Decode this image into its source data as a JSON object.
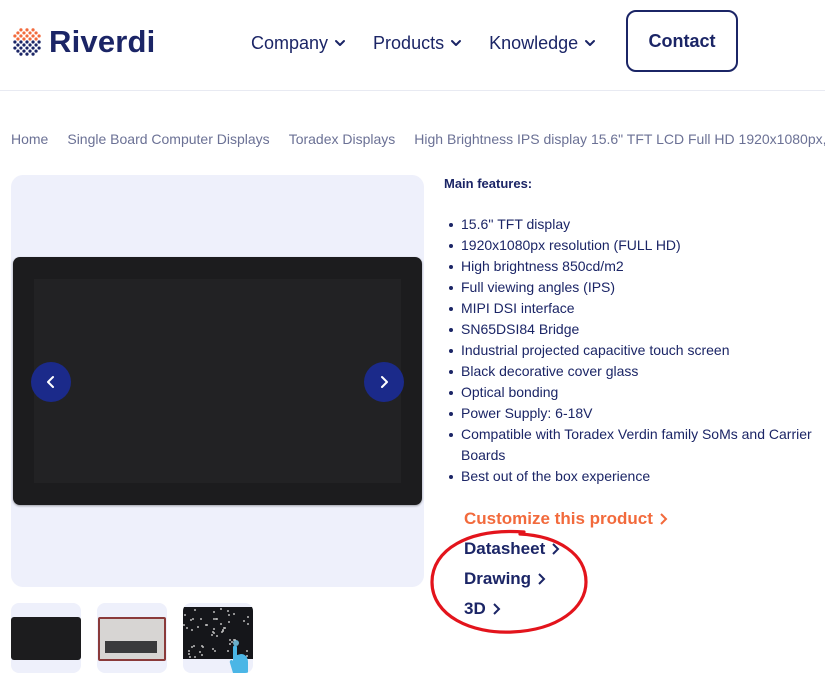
{
  "brand": {
    "name": "Riverdi",
    "accent": "#f26a3c",
    "navy": "#1b2566"
  },
  "nav": {
    "items": [
      {
        "label": "Company",
        "icon": "chevron-down-icon"
      },
      {
        "label": "Products",
        "icon": "chevron-down-icon"
      },
      {
        "label": "Knowledge",
        "icon": "chevron-down-icon"
      }
    ],
    "contact_label": "Contact"
  },
  "breadcrumb": [
    "Home",
    "Single Board Computer Displays",
    "Toradex Displays",
    "High Brightness IPS display 15.6\" TFT LCD Full HD 1920x1080px,"
  ],
  "gallery": {
    "prev_icon": "chevron-left-icon",
    "next_icon": "chevron-right-icon"
  },
  "features": {
    "title": "Main features:",
    "items": [
      "15.6'' TFT display",
      "1920x1080px resolution (FULL HD)",
      "High brightness 850cd/m2",
      "Full viewing angles (IPS)",
      "MIPI DSI interface",
      "SN65DSI84 Bridge",
      "Industrial projected capacitive touch screen",
      "Black decorative cover glass",
      "Optical bonding",
      "Power Supply: 6-18V",
      "Compatible with Toradex Verdin family SoMs and Carrier Boards",
      "Best out of the box experience"
    ]
  },
  "links": {
    "customize": "Customize this product",
    "datasheet": "Datasheet",
    "drawing": "Drawing",
    "model_3d": "3D"
  },
  "annotation_color": "#e3141c"
}
